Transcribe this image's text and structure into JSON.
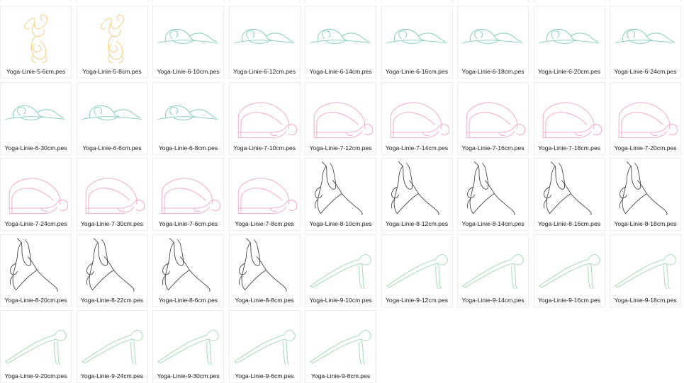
{
  "pose_colors": {
    "5": "#f7c97a",
    "6": "#7fcbb8",
    "7": "#f2a6c8",
    "8": "#3a3a3a",
    "9": "#9fd9b0"
  },
  "files": [
    {
      "name": "Yoga-Linie-5-6cm.pes",
      "pose": "5",
      "icon": "headstand-lotus-figure"
    },
    {
      "name": "Yoga-Linie-5-8cm.pes",
      "pose": "5",
      "icon": "headstand-lotus-figure"
    },
    {
      "name": "Yoga-Linie-6-10cm.pes",
      "pose": "6",
      "icon": "seated-forward-fold-figure"
    },
    {
      "name": "Yoga-Linie-6-12cm.pes",
      "pose": "6",
      "icon": "seated-forward-fold-figure"
    },
    {
      "name": "Yoga-Linie-6-14cm.pes",
      "pose": "6",
      "icon": "seated-forward-fold-figure"
    },
    {
      "name": "Yoga-Linie-6-16cm.pes",
      "pose": "6",
      "icon": "seated-forward-fold-figure"
    },
    {
      "name": "Yoga-Linie-6-18cm.pes",
      "pose": "6",
      "icon": "seated-forward-fold-figure"
    },
    {
      "name": "Yoga-Linie-6-20cm.pes",
      "pose": "6",
      "icon": "seated-forward-fold-figure"
    },
    {
      "name": "Yoga-Linie-6-24cm.pes",
      "pose": "6",
      "icon": "seated-forward-fold-figure"
    },
    {
      "name": "Yoga-Linie-6-30cm.pes",
      "pose": "6",
      "icon": "seated-forward-fold-figure"
    },
    {
      "name": "Yoga-Linie-6-6cm.pes",
      "pose": "6",
      "icon": "seated-forward-fold-figure"
    },
    {
      "name": "Yoga-Linie-6-8cm.pes",
      "pose": "6",
      "icon": "seated-forward-fold-figure"
    },
    {
      "name": "Yoga-Linie-7-10cm.pes",
      "pose": "7",
      "icon": "dolphin-pose-figure"
    },
    {
      "name": "Yoga-Linie-7-12cm.pes",
      "pose": "7",
      "icon": "dolphin-pose-figure"
    },
    {
      "name": "Yoga-Linie-7-14cm.pes",
      "pose": "7",
      "icon": "dolphin-pose-figure"
    },
    {
      "name": "Yoga-Linie-7-16cm.pes",
      "pose": "7",
      "icon": "dolphin-pose-figure"
    },
    {
      "name": "Yoga-Linie-7-18cm.pes",
      "pose": "7",
      "icon": "dolphin-pose-figure"
    },
    {
      "name": "Yoga-Linie-7-20cm.pes",
      "pose": "7",
      "icon": "dolphin-pose-figure"
    },
    {
      "name": "Yoga-Linie-7-24cm.pes",
      "pose": "7",
      "icon": "dolphin-pose-figure"
    },
    {
      "name": "Yoga-Linie-7-30cm.pes",
      "pose": "7",
      "icon": "dolphin-pose-figure"
    },
    {
      "name": "Yoga-Linie-7-6cm.pes",
      "pose": "7",
      "icon": "dolphin-pose-figure"
    },
    {
      "name": "Yoga-Linie-7-8cm.pes",
      "pose": "7",
      "icon": "dolphin-pose-figure"
    },
    {
      "name": "Yoga-Linie-8-10cm.pes",
      "pose": "8",
      "icon": "triangle-pose-figure"
    },
    {
      "name": "Yoga-Linie-8-12cm.pes",
      "pose": "8",
      "icon": "triangle-pose-figure"
    },
    {
      "name": "Yoga-Linie-8-14cm.pes",
      "pose": "8",
      "icon": "triangle-pose-figure"
    },
    {
      "name": "Yoga-Linie-8-16cm.pes",
      "pose": "8",
      "icon": "triangle-pose-figure"
    },
    {
      "name": "Yoga-Linie-8-18cm.pes",
      "pose": "8",
      "icon": "triangle-pose-figure"
    },
    {
      "name": "Yoga-Linie-8-20cm.pes",
      "pose": "8",
      "icon": "triangle-pose-figure"
    },
    {
      "name": "Yoga-Linie-8-22cm.pes",
      "pose": "8",
      "icon": "triangle-pose-figure"
    },
    {
      "name": "Yoga-Linie-8-6cm.pes",
      "pose": "8",
      "icon": "triangle-pose-figure"
    },
    {
      "name": "Yoga-Linie-8-8cm.pes",
      "pose": "8",
      "icon": "triangle-pose-figure"
    },
    {
      "name": "Yoga-Linie-9-10cm.pes",
      "pose": "9",
      "icon": "plank-pose-figure"
    },
    {
      "name": "Yoga-Linie-9-12cm.pes",
      "pose": "9",
      "icon": "plank-pose-figure"
    },
    {
      "name": "Yoga-Linie-9-14cm.pes",
      "pose": "9",
      "icon": "plank-pose-figure"
    },
    {
      "name": "Yoga-Linie-9-16cm.pes",
      "pose": "9",
      "icon": "plank-pose-figure"
    },
    {
      "name": "Yoga-Linie-9-18cm.pes",
      "pose": "9",
      "icon": "plank-pose-figure"
    },
    {
      "name": "Yoga-Linie-9-20cm.pes",
      "pose": "9",
      "icon": "plank-pose-figure"
    },
    {
      "name": "Yoga-Linie-9-24cm.pes",
      "pose": "9",
      "icon": "plank-pose-figure"
    },
    {
      "name": "Yoga-Linie-9-30cm.pes",
      "pose": "9",
      "icon": "plank-pose-figure"
    },
    {
      "name": "Yoga-Linie-9-6cm.pes",
      "pose": "9",
      "icon": "plank-pose-figure"
    },
    {
      "name": "Yoga-Linie-9-8cm.pes",
      "pose": "9",
      "icon": "plank-pose-figure"
    }
  ]
}
